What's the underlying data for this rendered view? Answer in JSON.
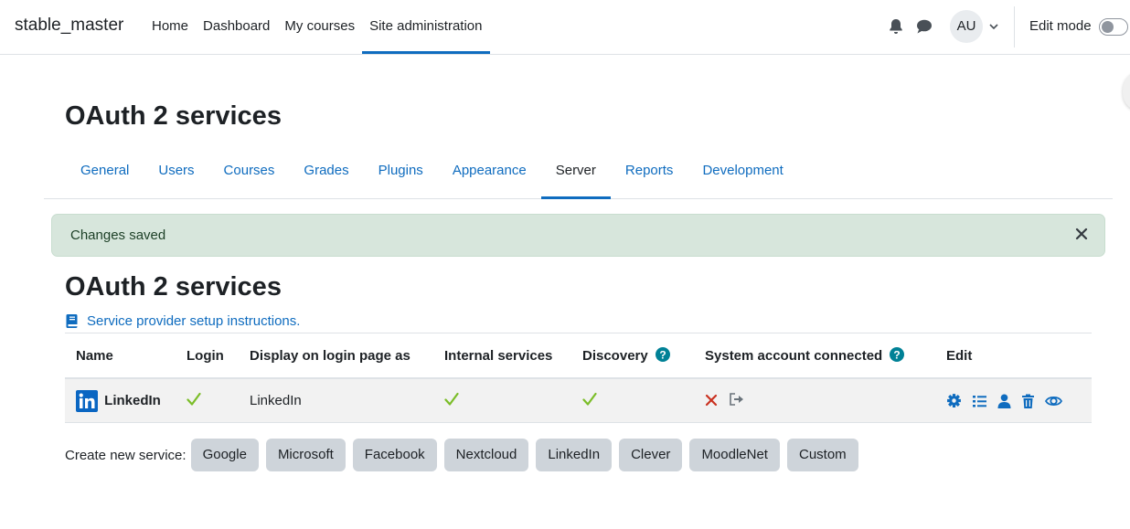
{
  "site_name": "stable_master",
  "primary_nav": [
    {
      "label": "Home",
      "active": false
    },
    {
      "label": "Dashboard",
      "active": false
    },
    {
      "label": "My courses",
      "active": false
    },
    {
      "label": "Site administration",
      "active": true
    }
  ],
  "user": {
    "initials": "AU"
  },
  "edit_mode_label": "Edit mode",
  "page_title": "OAuth 2 services",
  "admin_tabs": [
    {
      "label": "General"
    },
    {
      "label": "Users"
    },
    {
      "label": "Courses"
    },
    {
      "label": "Grades"
    },
    {
      "label": "Plugins"
    },
    {
      "label": "Appearance"
    },
    {
      "label": "Server",
      "active": true
    },
    {
      "label": "Reports"
    },
    {
      "label": "Development"
    }
  ],
  "alert": {
    "message": "Changes saved"
  },
  "section_title": "OAuth 2 services",
  "instructions_link": "Service provider setup instructions.",
  "table": {
    "headers": [
      "Name",
      "Login",
      "Display on login page as",
      "Internal services",
      "Discovery",
      "System account connected",
      "Edit"
    ],
    "rows": [
      {
        "name": "LinkedIn",
        "login": true,
        "display_as": "LinkedIn",
        "internal_services": true,
        "discovery": true,
        "system_account_connected": false
      }
    ]
  },
  "create_service": {
    "label": "Create new service:",
    "buttons": [
      "Google",
      "Microsoft",
      "Facebook",
      "Nextcloud",
      "LinkedIn",
      "Clever",
      "MoodleNet",
      "Custom"
    ]
  },
  "colors": {
    "link": "#0f6cbf",
    "success_bg": "#d7e6dc",
    "check": "#7bbd28",
    "cross": "#ca3120",
    "linkedin": "#0a66c2",
    "help": "#008196"
  },
  "icons": [
    "bell-icon",
    "chat-icon",
    "chevron-down-icon",
    "book-icon",
    "help-icon",
    "linkedin-icon",
    "check-icon",
    "cross-icon",
    "connect-icon",
    "gear-icon",
    "list-icon",
    "user-icon",
    "trash-icon",
    "eye-icon",
    "close-icon"
  ]
}
